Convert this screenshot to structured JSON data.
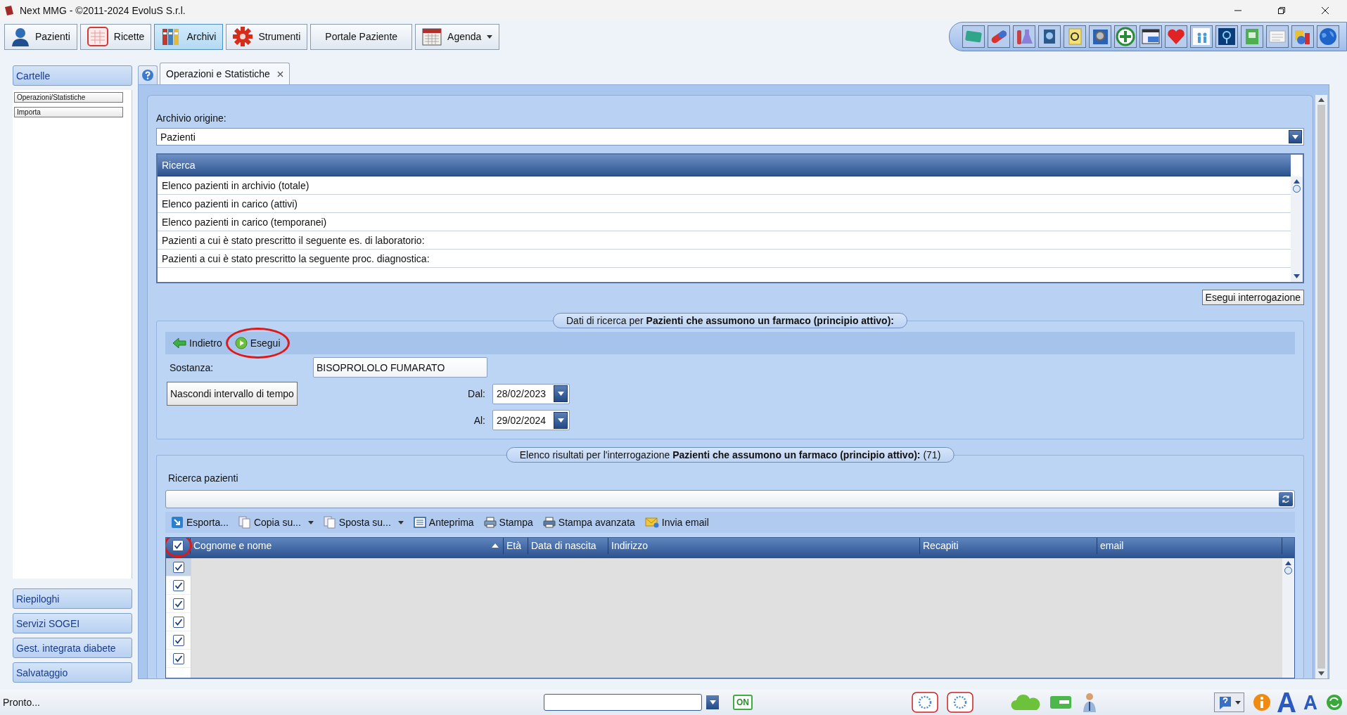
{
  "window": {
    "title": "Next MMG - ©2011-2024 EvoluS S.r.l."
  },
  "toolbar": [
    {
      "label": "Pazienti",
      "kind": "person",
      "selected": false,
      "dropdown": false
    },
    {
      "label": "Ricette",
      "kind": "prescription",
      "selected": false,
      "dropdown": false
    },
    {
      "label": "Archivi",
      "kind": "binders",
      "selected": true,
      "dropdown": false
    },
    {
      "label": "Strumenti",
      "kind": "gear",
      "selected": false,
      "dropdown": false
    },
    {
      "label": "Portale Paziente",
      "kind": "text",
      "selected": false,
      "dropdown": false
    },
    {
      "label": "Agenda",
      "kind": "calendar",
      "selected": false,
      "dropdown": true
    }
  ],
  "sidebar": {
    "header": "Cartelle",
    "items": [
      "Operazioni/Statistiche",
      "Importa"
    ],
    "sections": [
      "Riepiloghi",
      "Servizi SOGEI",
      "Gest. integrata diabete",
      "Salvataggio"
    ]
  },
  "tabs": [
    {
      "label": "Operazioni e Statistiche",
      "selected": true
    }
  ],
  "archive": {
    "label": "Archivio origine:",
    "value": "Pazienti"
  },
  "query_list": {
    "header": "Ricerca",
    "rows": [
      "Elenco pazienti in archivio (totale)",
      "Elenco pazienti in carico (attivi)",
      "Elenco pazienti in carico (temporanei)",
      "Pazienti a cui è stato prescritto il seguente es. di laboratorio:",
      "Pazienti a cui è stato prescritto la seguente proc. diagnostica:"
    ]
  },
  "run_query_button": "Esegui interrogazione",
  "search_params": {
    "legend": "Dati di ricerca per **Pazienti che assumono un farmaco (principio attivo):**",
    "actions": [
      {
        "label": "Indietro",
        "kind": "back",
        "circled": false
      },
      {
        "label": "Esegui",
        "kind": "run",
        "circled": true
      }
    ],
    "substance": {
      "label": "Sostanza:",
      "value": "BISOPROLOLO FUMARATO"
    },
    "toggle_button": "Nascondi intervallo di tempo",
    "dates": [
      {
        "label": "Dal:",
        "value": "28/02/2023"
      },
      {
        "label": "Al:",
        "value": "29/02/2024"
      }
    ]
  },
  "results": {
    "legend": "Elenco risultati per l'interrogazione **Pazienti che assumono un farmaco (principio attivo):** (71)",
    "search_label": "Ricerca pazienti",
    "actions": [
      {
        "label": "Esporta...",
        "kind": "export",
        "dropdown": false
      },
      {
        "label": "Copia su...",
        "kind": "copy",
        "dropdown": true
      },
      {
        "label": "Sposta su...",
        "kind": "move",
        "dropdown": true
      },
      {
        "label": "Anteprima",
        "kind": "preview",
        "dropdown": false
      },
      {
        "label": "Stampa",
        "kind": "print",
        "dropdown": false
      },
      {
        "label": "Stampa avanzata",
        "kind": "print-advanced",
        "dropdown": false
      },
      {
        "label": "Invia email",
        "kind": "email",
        "dropdown": false
      }
    ],
    "table": {
      "header_checked": true,
      "header_circled": true,
      "columns": [
        {
          "label": "Cognome e nome",
          "sorted": true
        },
        {
          "label": "Età",
          "sorted": false
        },
        {
          "label": "Data di nascita",
          "sorted": false
        },
        {
          "label": "Indirizzo",
          "sorted": false
        },
        {
          "label": "Recapiti",
          "sorted": false
        },
        {
          "label": "email",
          "sorted": false
        }
      ],
      "rows": [
        {
          "checked": true,
          "selected": true
        },
        {
          "checked": true,
          "selected": false
        },
        {
          "checked": true,
          "selected": false
        },
        {
          "checked": true,
          "selected": false
        },
        {
          "checked": true,
          "selected": false
        },
        {
          "checked": true,
          "selected": false
        }
      ]
    }
  },
  "status_bar": {
    "text": "Pronto...",
    "connection": "ON"
  }
}
